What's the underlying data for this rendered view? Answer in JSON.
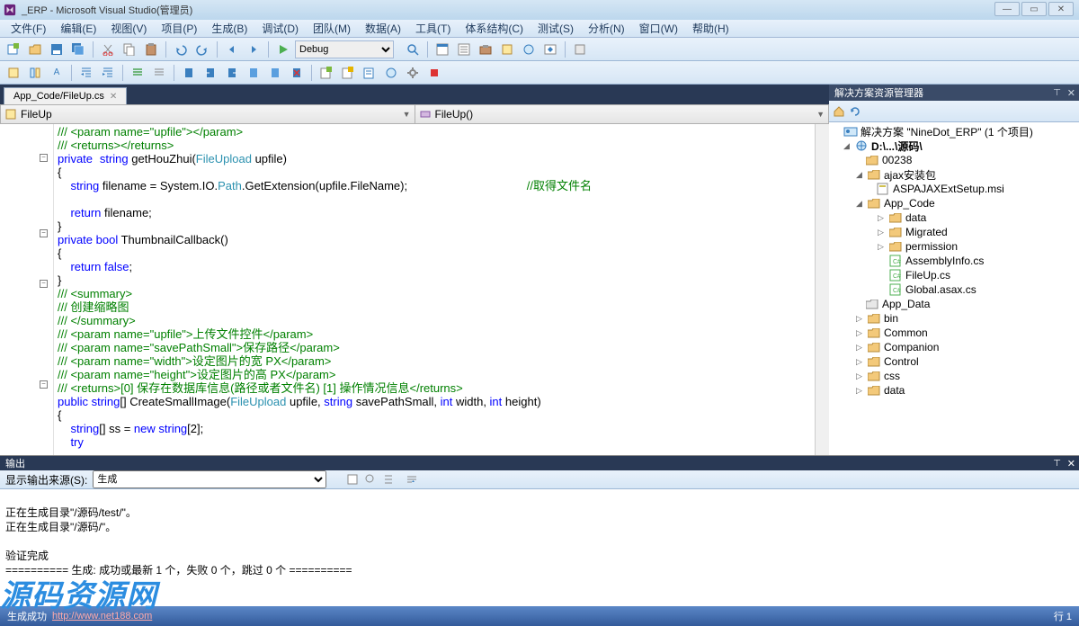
{
  "title": "_ERP - Microsoft Visual Studio(管理员)",
  "menu": [
    "文件(F)",
    "编辑(E)",
    "视图(V)",
    "项目(P)",
    "生成(B)",
    "调试(D)",
    "团队(M)",
    "数据(A)",
    "工具(T)",
    "体系结构(C)",
    "测试(S)",
    "分析(N)",
    "窗口(W)",
    "帮助(H)"
  ],
  "config": {
    "selected": "Debug"
  },
  "tab": {
    "name": "App_Code/FileUp.cs"
  },
  "nav": {
    "left": "FileUp",
    "right": "FileUp()"
  },
  "code": {
    "l1": "/// <param name=\"upfile\"></param>",
    "l2": "/// <returns></returns>",
    "l3a": "private",
    "l3b": "string",
    "l3c": " getHouZhui(",
    "l3d": "FileUpload",
    "l3e": " upfile)",
    "l4": "{",
    "l5a": "    string",
    "l5b": " filename = System.IO.",
    "l5c": "Path",
    "l5d": ".GetExtension(upfile.FileName);",
    "l5e": "//取得文件名",
    "l6": "",
    "l7a": "    return",
    "l7b": " filename;",
    "l8": "}",
    "l9a": "private",
    "l9b": " bool",
    "l9c": " ThumbnailCallback()",
    "l10": "{",
    "l11a": "    return",
    "l11b": " false",
    "l11c": ";",
    "l12": "}",
    "l13": "/// <summary>",
    "l14": "/// 创建缩略图",
    "l15": "/// </summary>",
    "l16a": "/// <param name=\"upfile\">",
    "l16b": "上传文件控件",
    "l16c": "</param>",
    "l17a": "/// <param name=\"savePathSmall\">",
    "l17b": "保存路径",
    "l17c": "</param>",
    "l18a": "/// <param name=\"width\">",
    "l18b": "设定图片的宽 PX",
    "l18c": "</param>",
    "l19a": "/// <param name=\"height\">",
    "l19b": "设定图片的高 PX",
    "l19c": "</param>",
    "l20a": "/// <returns>",
    "l20b": "[0] 保存在数据库信息(路径或者文件名) [1] 操作情况信息",
    "l20c": "</returns>",
    "l21a": "public",
    "l21b": " string",
    "l21c": "[] CreateSmallImage(",
    "l21d": "FileUpload",
    "l21e": " upfile, ",
    "l21f": "string",
    "l21g": " savePathSmall, ",
    "l21h": "int",
    "l21i": " width, ",
    "l21j": "int",
    "l21k": " height)",
    "l22": "{",
    "l23a": "    string",
    "l23b": "[] ss = ",
    "l23c": "new",
    "l23d": " string",
    "l23f": "[2];",
    "l24a": "    try"
  },
  "solution": {
    "title": "解决方案资源管理器",
    "root": "解决方案 \"NineDot_ERP\" (1 个项目)",
    "project": "D:\\...\\源码\\",
    "nodes": [
      "00238",
      "ajax安装包",
      "ASPAJAXExtSetup.msi",
      "App_Code",
      "data",
      "Migrated",
      "permission",
      "AssemblyInfo.cs",
      "FileUp.cs",
      "Global.asax.cs",
      "App_Data",
      "bin",
      "Common",
      "Companion",
      "Control",
      "css",
      "data"
    ]
  },
  "output": {
    "title": "输出",
    "from_label": "显示输出来源(S):",
    "source": "生成",
    "lines": [
      "正在生成目录\"/源码/test/\"。",
      "正在生成目录\"/源码/\"。",
      "",
      "验证完成",
      "========== 生成: 成功或最新 1 个，失败 0 个，跳过 0 个 =========="
    ]
  },
  "watermark": "源码资源网",
  "status": {
    "build": "生成成功",
    "url": "http://www.net188.com",
    "line": "行 1"
  }
}
